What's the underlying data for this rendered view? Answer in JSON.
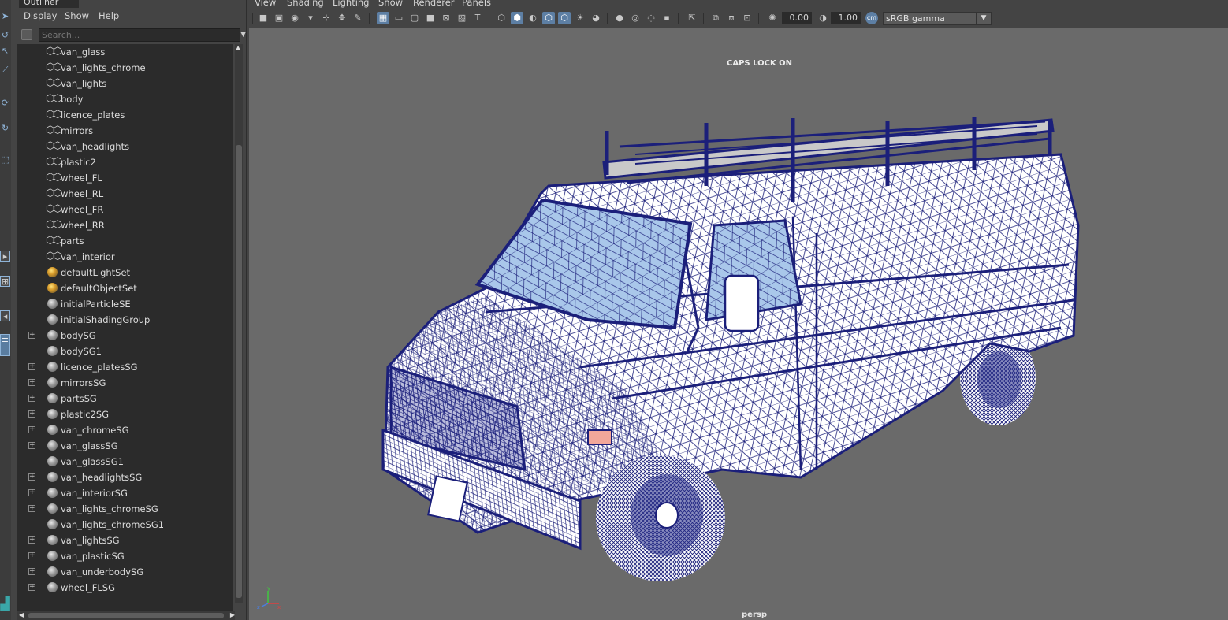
{
  "outliner": {
    "title": "Outliner",
    "menu": [
      "Display",
      "Show",
      "Help"
    ],
    "search_placeholder": "Search...",
    "items": [
      {
        "label": "van_glass",
        "icon": "mesh-icon",
        "expandable": false
      },
      {
        "label": "van_lights_chrome",
        "icon": "mesh-icon",
        "expandable": false
      },
      {
        "label": "van_lights",
        "icon": "mesh-icon",
        "expandable": false
      },
      {
        "label": "body",
        "icon": "mesh-icon",
        "expandable": false
      },
      {
        "label": "licence_plates",
        "icon": "mesh-icon",
        "expandable": false
      },
      {
        "label": "mirrors",
        "icon": "mesh-icon",
        "expandable": false
      },
      {
        "label": "van_headlights",
        "icon": "mesh-icon",
        "expandable": false
      },
      {
        "label": "plastic2",
        "icon": "mesh-icon",
        "expandable": false
      },
      {
        "label": "wheel_FL",
        "icon": "mesh-icon",
        "expandable": false
      },
      {
        "label": "wheel_RL",
        "icon": "mesh-icon",
        "expandable": false
      },
      {
        "label": "wheel_FR",
        "icon": "mesh-icon",
        "expandable": false
      },
      {
        "label": "wheel_RR",
        "icon": "mesh-icon",
        "expandable": false
      },
      {
        "label": "parts",
        "icon": "mesh-icon",
        "expandable": false
      },
      {
        "label": "van_interior",
        "icon": "mesh-icon",
        "expandable": false
      },
      {
        "label": "defaultLightSet",
        "icon": "light-set-icon",
        "expandable": false
      },
      {
        "label": "defaultObjectSet",
        "icon": "light-set-icon",
        "expandable": false
      },
      {
        "label": "initialParticleSE",
        "icon": "shading-group-icon",
        "expandable": false
      },
      {
        "label": "initialShadingGroup",
        "icon": "shading-group-icon",
        "expandable": false
      },
      {
        "label": "bodySG",
        "icon": "shading-group-icon",
        "expandable": true
      },
      {
        "label": "bodySG1",
        "icon": "shading-group-icon",
        "expandable": false
      },
      {
        "label": "licence_platesSG",
        "icon": "shading-group-icon",
        "expandable": true
      },
      {
        "label": "mirrorsSG",
        "icon": "shading-group-icon",
        "expandable": true
      },
      {
        "label": "partsSG",
        "icon": "shading-group-icon",
        "expandable": true
      },
      {
        "label": "plastic2SG",
        "icon": "shading-group-icon",
        "expandable": true
      },
      {
        "label": "van_chromeSG",
        "icon": "shading-group-icon",
        "expandable": true
      },
      {
        "label": "van_glassSG",
        "icon": "shading-group-icon",
        "expandable": true
      },
      {
        "label": "van_glassSG1",
        "icon": "shading-group-icon",
        "expandable": false
      },
      {
        "label": "van_headlightsSG",
        "icon": "shading-group-icon",
        "expandable": true
      },
      {
        "label": "van_interiorSG",
        "icon": "shading-group-icon",
        "expandable": true
      },
      {
        "label": "van_lights_chromeSG",
        "icon": "shading-group-icon",
        "expandable": true
      },
      {
        "label": "van_lights_chromeSG1",
        "icon": "shading-group-icon",
        "expandable": false
      },
      {
        "label": "van_lightsSG",
        "icon": "shading-group-icon",
        "expandable": true
      },
      {
        "label": "van_plasticSG",
        "icon": "shading-group-icon",
        "expandable": true
      },
      {
        "label": "van_underbodySG",
        "icon": "shading-group-icon",
        "expandable": true
      },
      {
        "label": "wheel_FLSG",
        "icon": "shading-group-icon",
        "expandable": true
      }
    ]
  },
  "viewport": {
    "menu": [
      "View",
      "Shading",
      "Lighting",
      "Show",
      "Renderer",
      "Panels"
    ],
    "exposure": "0.00",
    "gamma": "1.00",
    "color_space": "sRGB gamma",
    "caps_lock_message": "CAPS LOCK ON",
    "camera_label": "persp",
    "axis_labels": {
      "y": "y",
      "x": "x",
      "z": "z"
    }
  },
  "colors": {
    "wire": "#1b1f7a",
    "glass": "#a9c7ea",
    "accent": "#5d7fa4",
    "viewport_bg": "#6a6a6a"
  }
}
